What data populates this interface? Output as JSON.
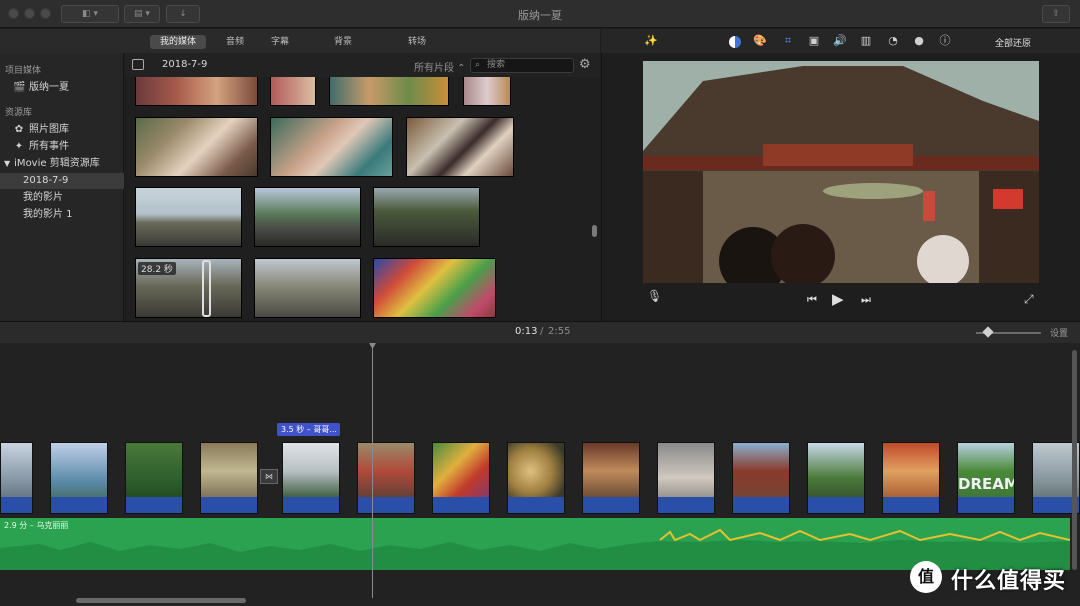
{
  "window": {
    "title": "版纳一夏"
  },
  "media_tabs": [
    "我的媒体",
    "音频",
    "字幕",
    "背景",
    "转场"
  ],
  "sidebar": {
    "project_header": "项目媒体",
    "project_item": "版纳一夏",
    "library_header": "资源库",
    "items": [
      "照片图库",
      "所有事件",
      "iMovie 剪辑资源库",
      "2018-7-9",
      "我的影片",
      "我的影片 1"
    ]
  },
  "browser": {
    "date": "2018-7-9",
    "filter": "所有片段",
    "search_placeholder": "搜索",
    "selected_duration": "28.2 秒"
  },
  "viewer": {
    "reset_all": "全部还原"
  },
  "timeline": {
    "current_time": "0:13",
    "separator": "/",
    "total_time": "2:55",
    "settings": "设置",
    "clip_label": "3.5 秒 – 哥哥...",
    "audio_label": "2.9 分 – 乌克丽丽"
  },
  "watermark": {
    "text": "什么值得买"
  },
  "colors": {
    "audio_green": "#2aa24f",
    "clip_blue": "#2a4fa8",
    "accent_blue": "#3f74d6"
  }
}
